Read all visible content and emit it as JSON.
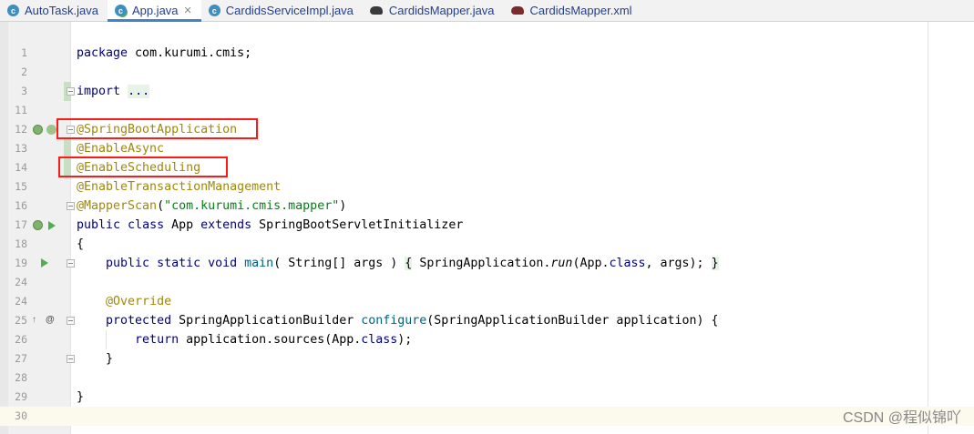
{
  "tabs": [
    {
      "label": "AutoTask.java",
      "icon": "java-class-icon",
      "active": false
    },
    {
      "label": "App.java",
      "icon": "java-app-icon",
      "active": true,
      "close": "✕"
    },
    {
      "label": "CardidsServiceImpl.java",
      "icon": "java-class-icon",
      "active": false
    },
    {
      "label": "CardidsMapper.java",
      "icon": "mapper-icon",
      "active": false
    },
    {
      "label": "CardidsMapper.xml",
      "icon": "mapper-xml-icon",
      "active": false
    }
  ],
  "lines": [
    {
      "num": "1",
      "text": "package com.kurumi.cmis;"
    },
    {
      "num": "2",
      "text": ""
    },
    {
      "num": "3",
      "text": "import ..."
    },
    {
      "num": "11",
      "text": ""
    },
    {
      "num": "12",
      "text": "@SpringBootApplication"
    },
    {
      "num": "13",
      "text": "@EnableAsync"
    },
    {
      "num": "14",
      "text": "@EnableScheduling"
    },
    {
      "num": "15",
      "text": "@EnableTransactionManagement"
    },
    {
      "num": "16",
      "text": "@MapperScan(\"com.kurumi.cmis.mapper\")"
    },
    {
      "num": "17",
      "text": "public class App extends SpringBootServletInitializer"
    },
    {
      "num": "18",
      "text": "{"
    },
    {
      "num": "19",
      "text": "    public static void main( String[] args ) { SpringApplication.run(App.class, args); }"
    },
    {
      "num": "24",
      "text": ""
    },
    {
      "num": "24",
      "text": "    @Override"
    },
    {
      "num": "25",
      "text": "    protected SpringApplicationBuilder configure(SpringApplicationBuilder application) {"
    },
    {
      "num": "26",
      "text": "        return application.sources(App.class);"
    },
    {
      "num": "27",
      "text": "    }"
    },
    {
      "num": "28",
      "text": ""
    },
    {
      "num": "29",
      "text": "}"
    },
    {
      "num": "30",
      "text": ""
    }
  ],
  "tokens": {
    "package_kw": "package",
    "package_name": " com.kurumi.cmis;",
    "import_kw": "import",
    "import_dots": "...",
    "a12": "@SpringBootApplication",
    "a13": "@EnableAsync",
    "a14": "@EnableScheduling",
    "a15": "@EnableTransactionManagement",
    "a16": "@MapperScan",
    "a16_open": "(",
    "a16_str": "\"com.kurumi.cmis.mapper\"",
    "a16_close": ")",
    "l17_public": "public",
    "l17_class": " class",
    " l17_space": "",
    "l17_name": " App ",
    "l17_extends": "extends",
    "l17_super": " SpringBootServletInitializer",
    "l18": "{",
    "l19_indent": "    ",
    "l19_public": "public",
    "l19_static": " static",
    "l19_void": " void",
    "l19_main": " main",
    "l19_params": "( String[] args ) ",
    "l19_body_open": "{",
    "l19_body_mid": " SpringApplication.",
    "l19_run": "run",
    "l19_args": "(App.",
    "l19_classkw": "class",
    "l19_rest": ", args); ",
    "l19_body_close": "}",
    "l24_indent": "    ",
    "l24_override": "@Override",
    "l25_indent": "    ",
    "l25_protected": "protected",
    "l25_type": " SpringApplicationBuilder ",
    "l25_configure": "configure",
    "l25_rest": "(SpringApplicationBuilder application) {",
    "l26_indent": "        ",
    "l26_return": "return",
    "l26_mid": " application.sources(App.",
    "l26_classkw": "class",
    "l26_rest": ");",
    "l27": "    }",
    "l29": "}"
  },
  "watermark": "CSDN @程似锦吖",
  "colors": {
    "keyword": "#000080",
    "annotation": "#9e880d",
    "string": "#067d17",
    "method": "#00627a",
    "highlight_box": "#ff1a1a",
    "caret_line": "#fcfaed"
  }
}
